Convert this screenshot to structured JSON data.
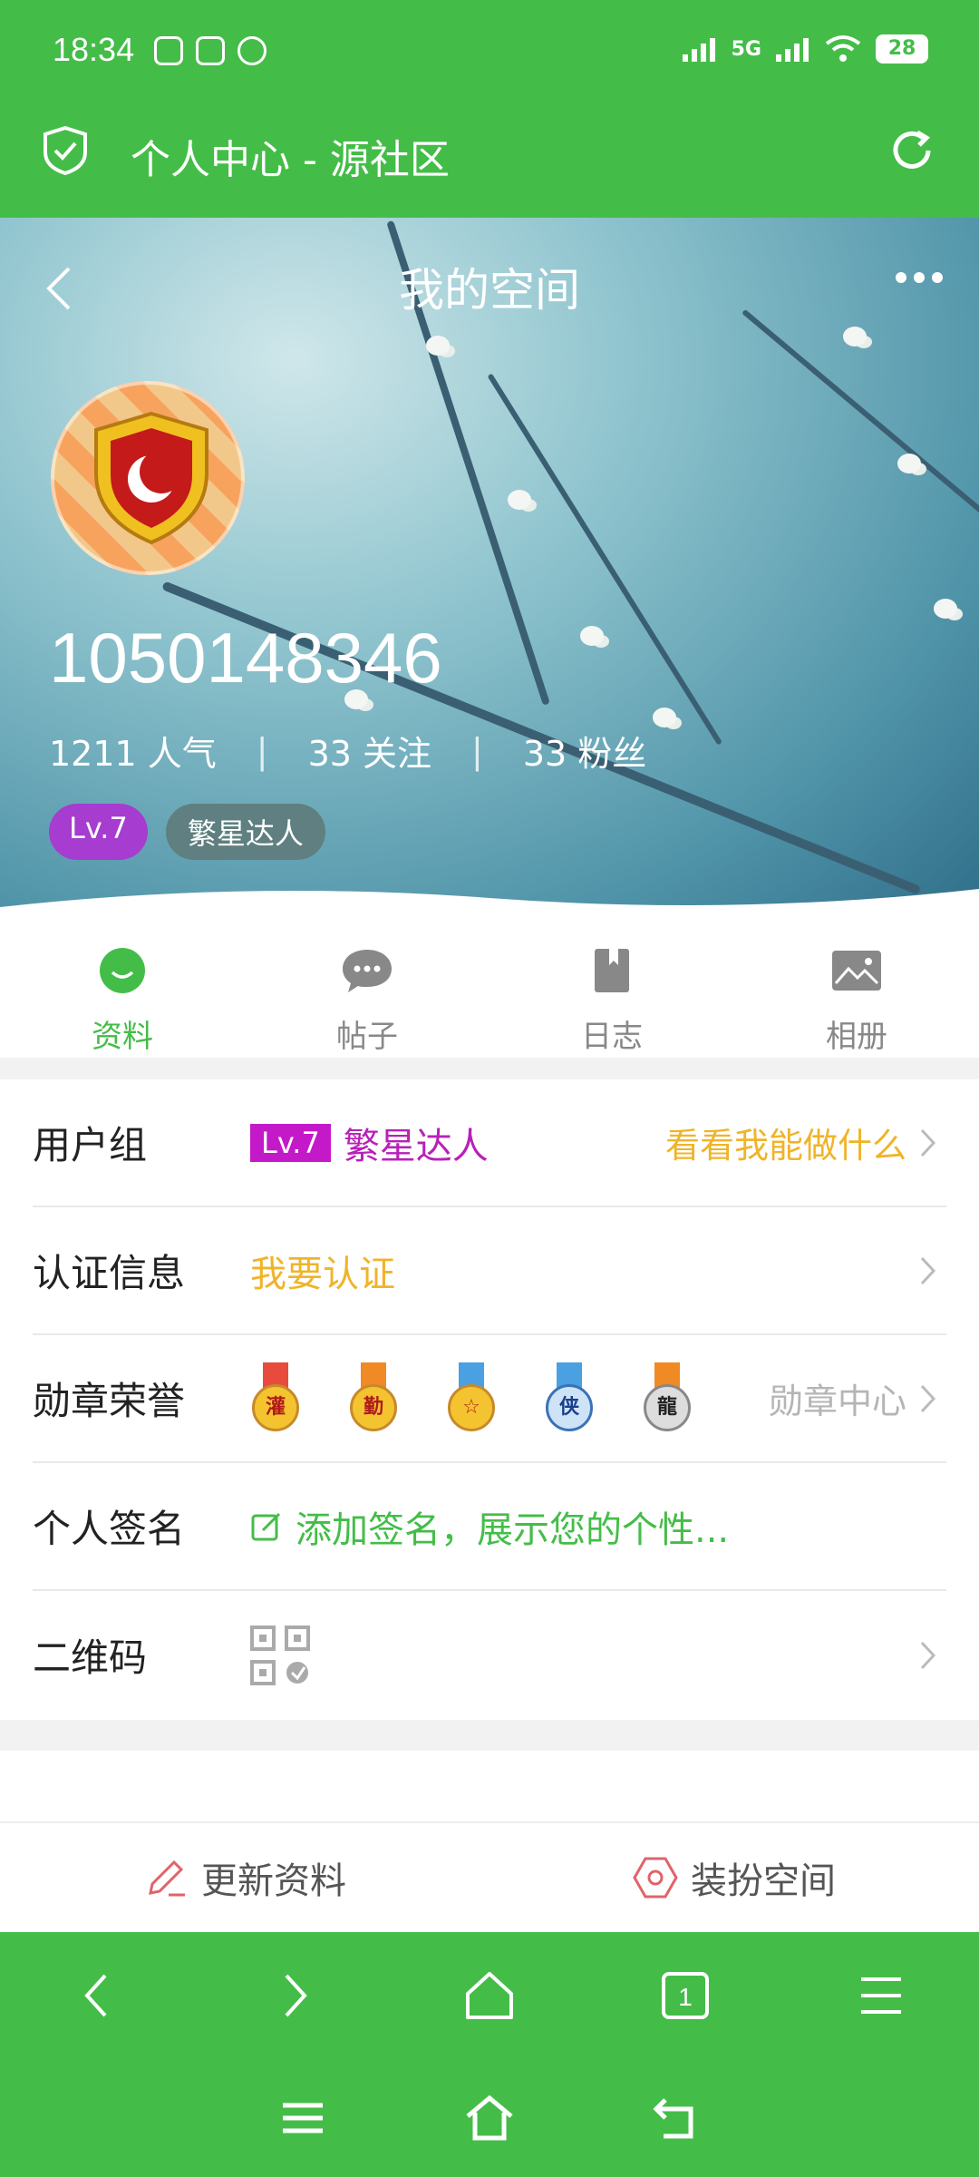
{
  "status": {
    "time": "18:34",
    "network": "5G",
    "battery": "28"
  },
  "titlebar": {
    "title": "个人中心 - 源社区"
  },
  "hero": {
    "title": "我的空间",
    "uid": "1050148346",
    "stats": [
      {
        "label": "1211 人气"
      },
      {
        "label": "33 关注"
      },
      {
        "label": "33 粉丝"
      }
    ],
    "level_tag": "Lv.7",
    "rank_tag": "繁星达人"
  },
  "tabs": [
    {
      "label": "资料",
      "active": true
    },
    {
      "label": "帖子",
      "active": false
    },
    {
      "label": "日志",
      "active": false
    },
    {
      "label": "相册",
      "active": false
    }
  ],
  "info": {
    "group": {
      "label": "用户组",
      "level": "Lv.7",
      "rank": "繁星达人",
      "action": "看看我能做什么"
    },
    "verify": {
      "label": "认证信息",
      "value": "我要认证"
    },
    "medals": {
      "label": "勋章荣誉",
      "items": [
        "灌",
        "勤",
        "☆",
        "侠",
        "龍"
      ],
      "action": "勋章中心"
    },
    "signature": {
      "label": "个人签名",
      "placeholder": "添加签名，展示您的个性..."
    },
    "qrcode": {
      "label": "二维码"
    }
  },
  "actions": {
    "update": "更新资料",
    "decorate": "装扮空间"
  },
  "browser": {
    "tab_count": "1"
  },
  "colors": {
    "accent": "#44bd48",
    "purple": "#b820b8",
    "yellow": "#f0b429"
  }
}
